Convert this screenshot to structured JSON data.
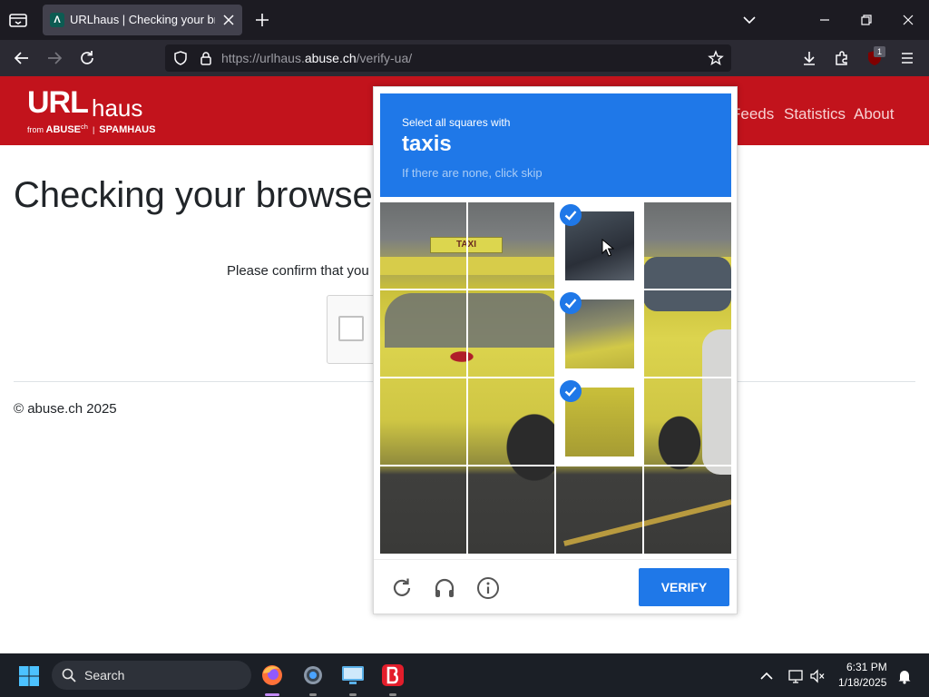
{
  "browser": {
    "tab_title": "URLhaus | Checking your browser",
    "favicon_letter": "Λ",
    "url_prefix": "https://urlhaus.",
    "url_host": "abuse.ch",
    "url_path": "/verify-ua/",
    "extension_badge": "1"
  },
  "site": {
    "logo_main": "URL",
    "logo_suffix": "haus",
    "logo_from": "from",
    "logo_abuse": "ABUSE",
    "logo_abuse_sup": "ch",
    "logo_spamhaus": "SPAMHAUS",
    "nav": [
      "Feeds",
      "Statistics",
      "About"
    ],
    "page_title": "Checking your browser",
    "confirm_text": "Please confirm that you",
    "footer": "© abuse.ch 2025"
  },
  "captcha": {
    "prompt_line": "Select all squares with",
    "target": "taxis",
    "hint": "If there are none, click skip",
    "taxi_sign_text": "TAXI",
    "selected_tiles": [
      2,
      6,
      10
    ],
    "verify_label": "VERIFY",
    "controls": [
      "refresh-icon",
      "headphones-icon",
      "info-icon"
    ],
    "accent_color": "#1f78e8"
  },
  "taskbar": {
    "search_label": "Search",
    "time": "6:31 PM",
    "date": "1/18/2025",
    "apps": [
      "firefox",
      "settings",
      "remote-desktop",
      "bitdefender"
    ]
  }
}
